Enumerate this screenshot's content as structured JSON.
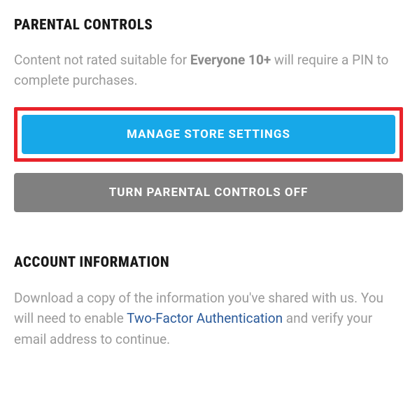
{
  "parental": {
    "heading": "PARENTAL CONTROLS",
    "description_pre": "Content not rated suitable for ",
    "description_bold": "Everyone 10+",
    "description_post": " will require a PIN to complete purchases.",
    "manage_button": "MANAGE STORE SETTINGS",
    "turn_off_button": "TURN PARENTAL CONTROLS OFF"
  },
  "account": {
    "heading": "ACCOUNT INFORMATION",
    "description_pre": "Download a copy of the information you've shared with us. You will need to enable ",
    "link_text": "Two-Factor Authentication",
    "description_post": " and verify your email address to continue."
  }
}
